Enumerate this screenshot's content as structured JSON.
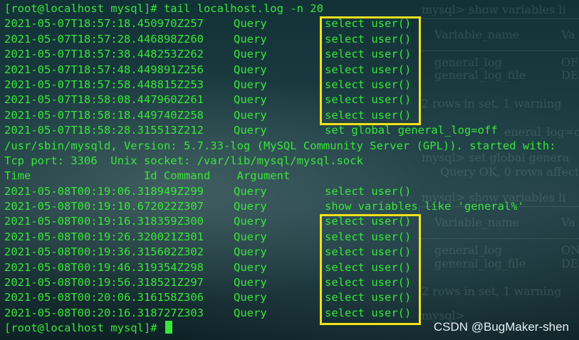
{
  "prompt_command": "[root@localhost mysql]# tail localhost.log -n 20",
  "log_rows_a": [
    {
      "ts": "2021-05-07T18:57:18.450970Z",
      "id": "257",
      "cmd": "Query",
      "arg": "select user()"
    },
    {
      "ts": "2021-05-07T18:57:28.446898Z",
      "id": "260",
      "cmd": "Query",
      "arg": "select user()"
    },
    {
      "ts": "2021-05-07T18:57:38.448253Z",
      "id": "262",
      "cmd": "Query",
      "arg": "select user()"
    },
    {
      "ts": "2021-05-07T18:57:48.449891Z",
      "id": "256",
      "cmd": "Query",
      "arg": "select user()"
    },
    {
      "ts": "2021-05-07T18:57:58.448815Z",
      "id": "253",
      "cmd": "Query",
      "arg": "select user()"
    },
    {
      "ts": "2021-05-07T18:58:08.447960Z",
      "id": "261",
      "cmd": "Query",
      "arg": "select user()"
    },
    {
      "ts": "2021-05-07T18:58:18.449740Z",
      "id": "258",
      "cmd": "Query",
      "arg": "select user()"
    },
    {
      "ts": "2021-05-07T18:58:28.315513Z",
      "id": "212",
      "cmd": "Query",
      "arg": "set global general_log=off"
    }
  ],
  "server_info_line": "/usr/sbin/mysqld, Version: 5.7.33-log (MySQL Community Server (GPL)). started with:",
  "socket_line": "Tcp port: 3306  Unix socket: /var/lib/mysql/mysql.sock",
  "header_line": "Time                 Id Command    Argument",
  "log_rows_b": [
    {
      "ts": "2021-05-08T00:19:06.318949Z",
      "id": "299",
      "cmd": "Query",
      "arg": "select user()"
    },
    {
      "ts": "2021-05-08T00:19:10.672022Z",
      "id": "307",
      "cmd": "Query",
      "arg": "show variables like 'general%'"
    },
    {
      "ts": "2021-05-08T00:19:16.318359Z",
      "id": "300",
      "cmd": "Query",
      "arg": "select user()"
    },
    {
      "ts": "2021-05-08T00:19:26.320021Z",
      "id": "301",
      "cmd": "Query",
      "arg": "select user()"
    },
    {
      "ts": "2021-05-08T00:19:36.315602Z",
      "id": "302",
      "cmd": "Query",
      "arg": "select user()"
    },
    {
      "ts": "2021-05-08T00:19:46.319354Z",
      "id": "298",
      "cmd": "Query",
      "arg": "select user()"
    },
    {
      "ts": "2021-05-08T00:19:56.318521Z",
      "id": "297",
      "cmd": "Query",
      "arg": "select user()"
    },
    {
      "ts": "2021-05-08T00:20:06.316158Z",
      "id": "306",
      "cmd": "Query",
      "arg": "select user()"
    },
    {
      "ts": "2021-05-08T00:20:16.318727Z",
      "id": "303",
      "cmd": "Query",
      "arg": "select user()"
    }
  ],
  "final_prompt": "[root@localhost mysql]# ",
  "background_window": {
    "l1": "mysql> show variables li",
    "l2": "Variable_name",
    "l3": "Va",
    "l4": "general_log",
    "l5": "OFF",
    "l6": "general_log_file",
    "l7": "DES",
    "l8": "2 rows in set, 1 warning",
    "l9": "eneral_log=o",
    "l10": "mysql> set global genera",
    "l11": "Query OK, 0 rows affecte",
    "l12": "mysql> show variables li",
    "l13": "Variable_name",
    "l14": "Va",
    "l15": "general_log",
    "l16": "ON",
    "l17": "general_log_file",
    "l18": "DES",
    "l19": "2 rows in set, 1 warning",
    "l20": "mysql>"
  },
  "watermark": "CSDN @BugMaker-shen",
  "colors": {
    "terminal_text": "#39e639",
    "highlight": "#f2e21c"
  }
}
